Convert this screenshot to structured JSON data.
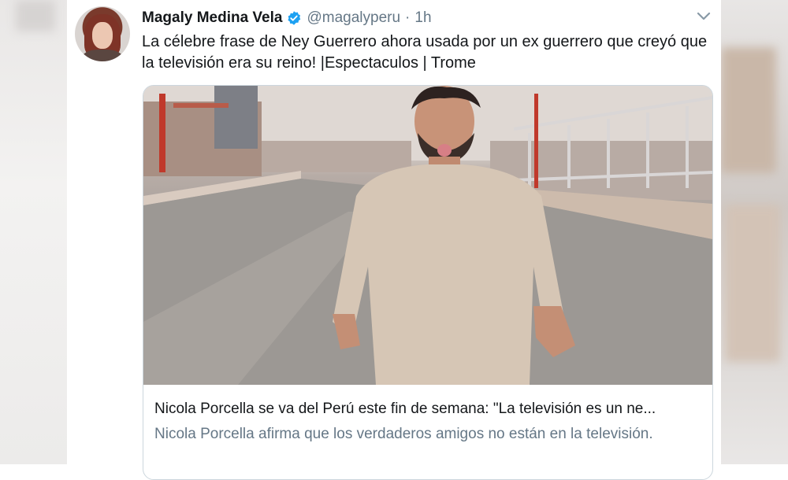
{
  "author": {
    "name": "Magaly Medina Vela",
    "handle": "@magalyperu",
    "separator": "·",
    "time": "1h",
    "verified_icon": "verified-badge-icon",
    "avatar_icon": "profile-avatar"
  },
  "tweet": {
    "text": "La célebre frase de Ney Guerrero ahora usada por un ex guerrero que creyó que la televisión era su reino!  |Espectaculos | Trome"
  },
  "card": {
    "title": "Nicola Porcella se va del Perú este fin de semana: \"La televisión es un ne...",
    "description": "Nicola Porcella afirma que los verdaderos amigos no están en la televisión."
  },
  "colors": {
    "verified": "#1da1f2",
    "secondary_text": "#657786",
    "card_border": "#ccd6dd"
  }
}
